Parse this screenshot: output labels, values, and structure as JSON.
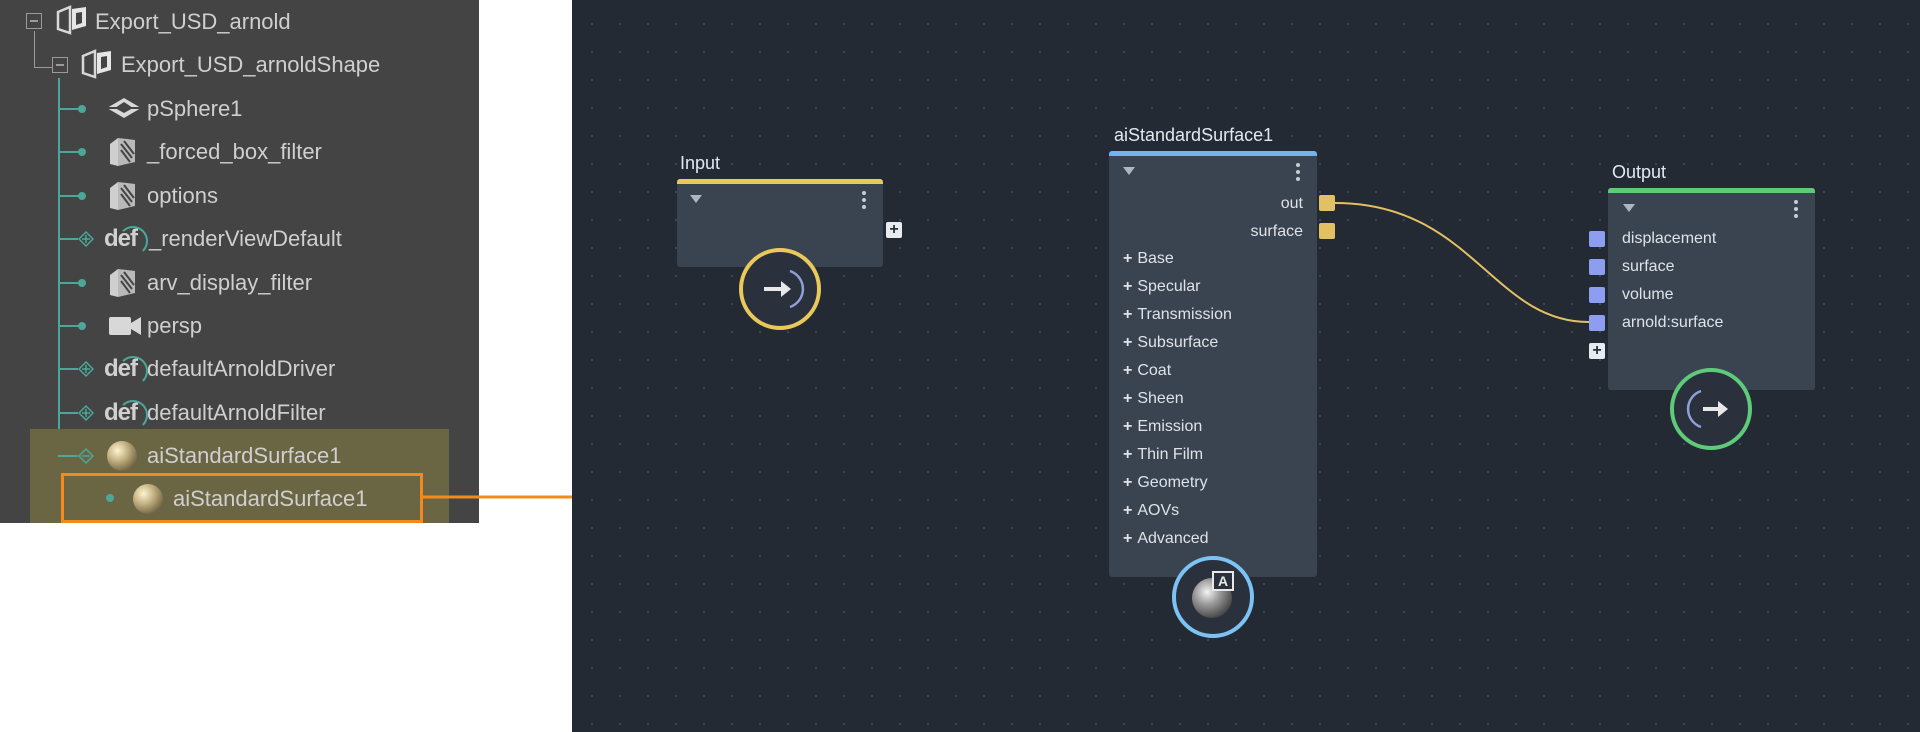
{
  "outliner": {
    "items": [
      {
        "label": "Export_USD_arnold",
        "icon": "usd-stage-icon"
      },
      {
        "label": "Export_USD_arnoldShape",
        "icon": "usd-stage-icon"
      },
      {
        "label": "pSphere1",
        "icon": "mesh-icon"
      },
      {
        "label": "_forced_box_filter",
        "icon": "filter-icon"
      },
      {
        "label": "options",
        "icon": "filter-icon"
      },
      {
        "label": "_renderViewDefault",
        "icon": "def-icon"
      },
      {
        "label": "arv_display_filter",
        "icon": "filter-icon"
      },
      {
        "label": "persp",
        "icon": "camera-icon"
      },
      {
        "label": "defaultArnoldDriver",
        "icon": "def-icon"
      },
      {
        "label": "defaultArnoldFilter",
        "icon": "def-icon"
      },
      {
        "label": "aiStandardSurface1",
        "icon": "shader-sphere-icon"
      },
      {
        "label": "aiStandardSurface1",
        "icon": "shader-sphere-icon"
      }
    ],
    "def_text": "def",
    "selection_color": "#6a6644",
    "highlight_color": "#f48a1c"
  },
  "graph": {
    "input_node": {
      "title": "Input",
      "color": "#e8c95a"
    },
    "shader_node": {
      "title": "aiStandardSurface1",
      "color": "#6fb4ea",
      "outputs": [
        "out",
        "surface"
      ],
      "sections": [
        "Base",
        "Specular",
        "Transmission",
        "Subsurface",
        "Coat",
        "Sheen",
        "Emission",
        "Thin Film",
        "Geometry",
        "AOVs",
        "Advanced"
      ],
      "badge_letter": "A"
    },
    "output_node": {
      "title": "Output",
      "color": "#5ecb7a",
      "inputs": [
        "displacement",
        "surface",
        "volume",
        "arnold:surface"
      ]
    },
    "port_output_color": "#e2c064",
    "port_input_color": "#8d9ef0",
    "connection_color": "#e2c064",
    "add_symbol": "+",
    "section_plus": "+"
  }
}
